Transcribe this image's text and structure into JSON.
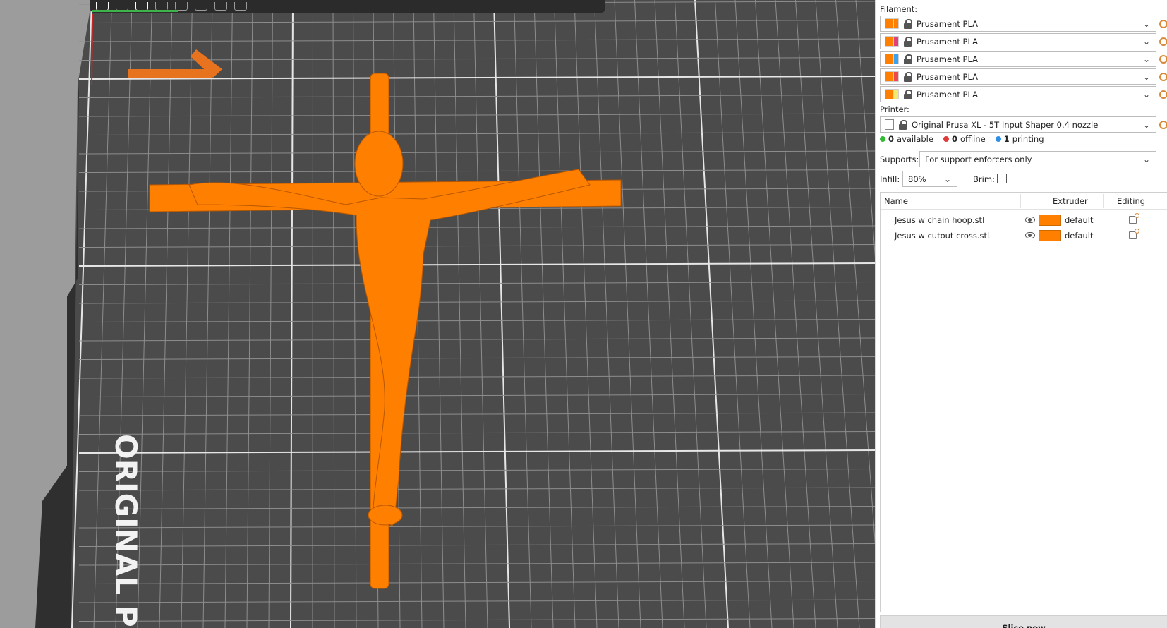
{
  "viewport": {
    "bed_label": "ORIGINAL PR",
    "model_color": "#ff7f00"
  },
  "panel": {
    "filament_label": "Filament:",
    "filaments": [
      {
        "name": "Prusament PLA",
        "color": "#ff8000",
        "extruder_color": "#ff8000"
      },
      {
        "name": "Prusament PLA",
        "color": "#ff8000",
        "extruder_color": "#e0407a"
      },
      {
        "name": "Prusament PLA",
        "color": "#ff8000",
        "extruder_color": "#3aa0f0"
      },
      {
        "name": "Prusament PLA",
        "color": "#ff8000",
        "extruder_color": "#f04848"
      },
      {
        "name": "Prusament PLA",
        "color": "#ff8000",
        "extruder_color": "#f5e870"
      }
    ],
    "printer_label": "Printer:",
    "printer": "Original Prusa XL - 5T Input Shaper 0.4 nozzle",
    "status": [
      {
        "count": "0",
        "label": "available",
        "color": "#33bb33"
      },
      {
        "count": "0",
        "label": "offline",
        "color": "#e03a3a"
      },
      {
        "count": "1",
        "label": "printing",
        "color": "#2f8fe8"
      }
    ],
    "supports_label": "Supports:",
    "supports_value": "For support enforcers only",
    "infill_label": "Infill:",
    "infill_value": "80%",
    "brim_label": "Brim:",
    "object_list": {
      "columns": {
        "name": "Name",
        "extruder": "Extruder",
        "editing": "Editing"
      },
      "rows": [
        {
          "name": "Jesus w chain hoop.stl",
          "extruder": "default"
        },
        {
          "name": "Jesus w cutout cross.stl",
          "extruder": "default"
        }
      ]
    },
    "slice_button": "Slice now"
  }
}
